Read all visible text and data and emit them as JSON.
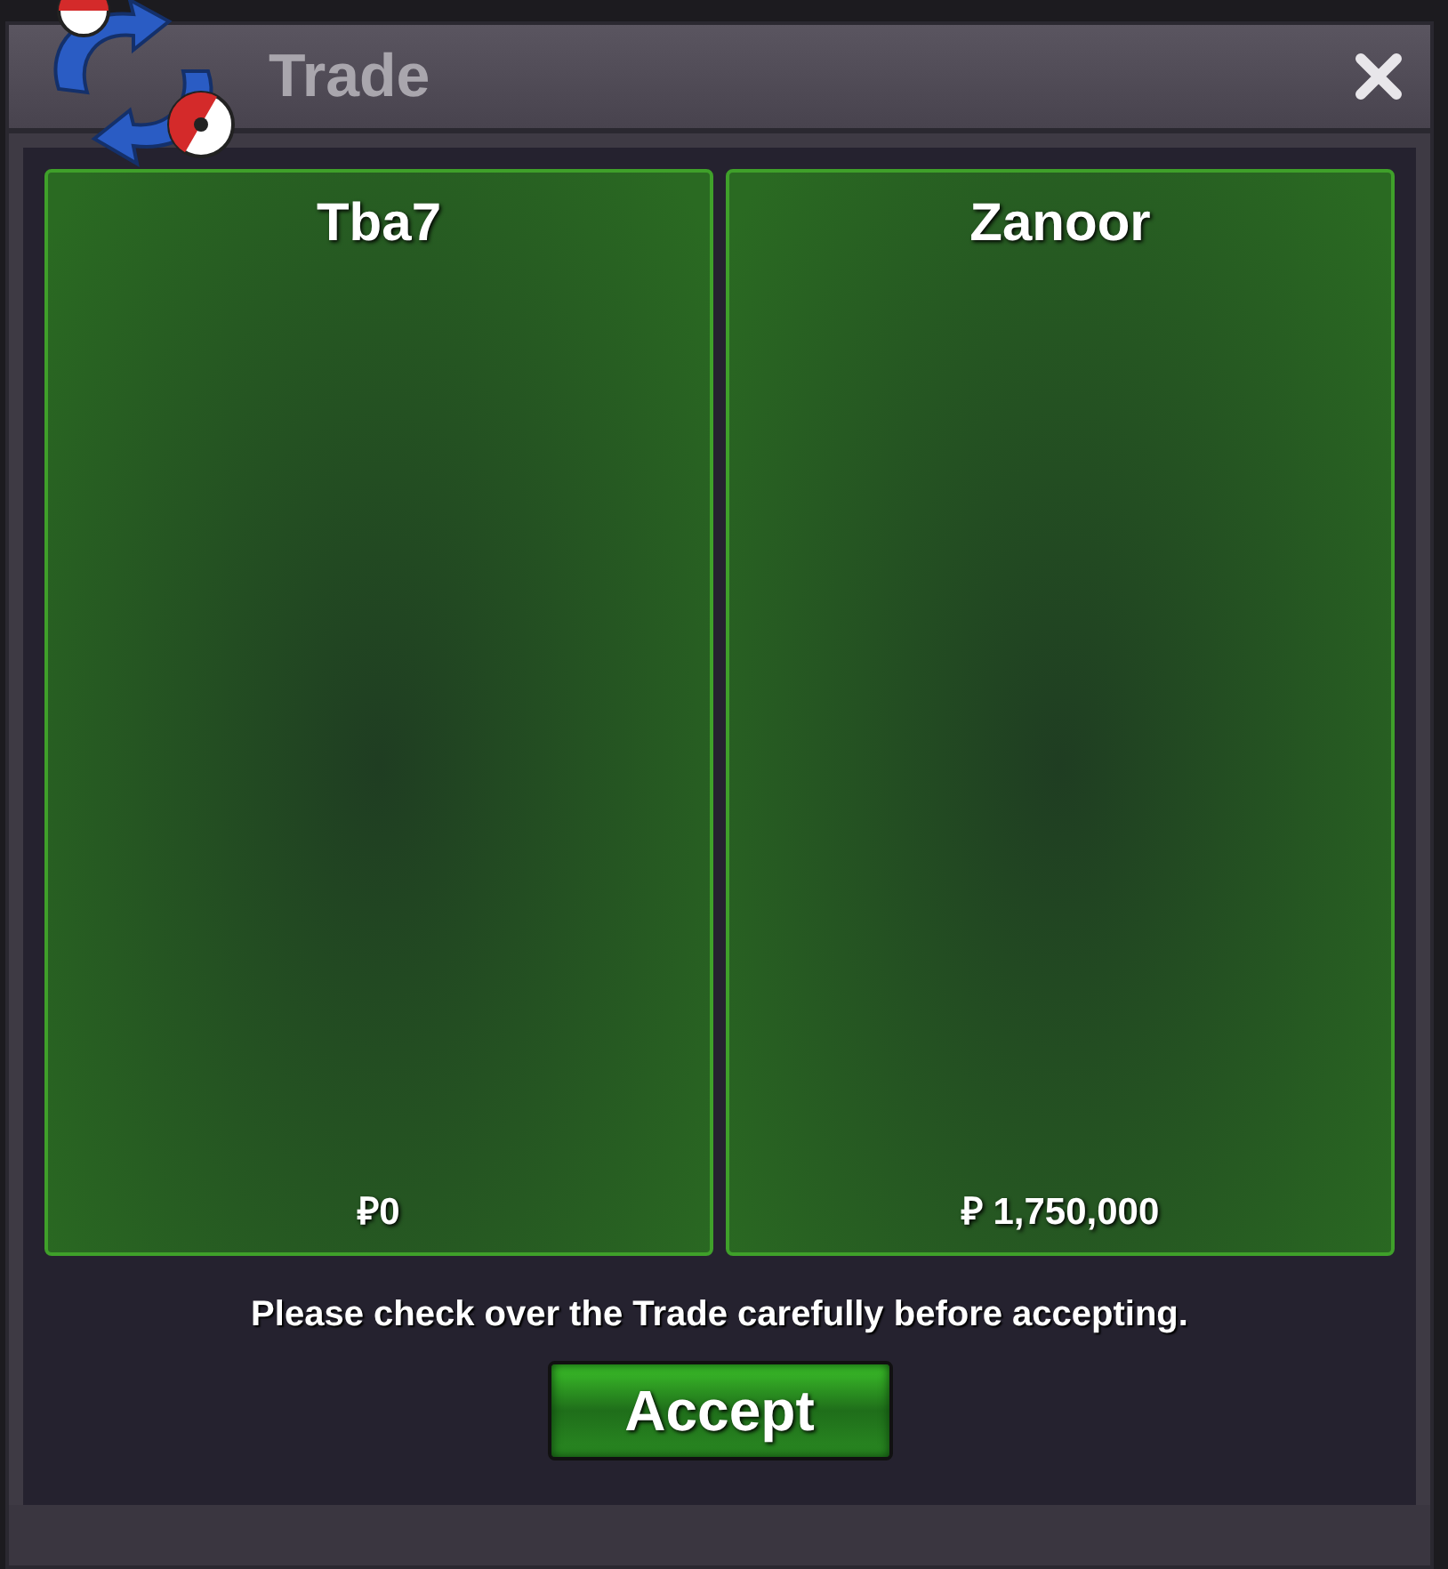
{
  "window": {
    "title": "Trade"
  },
  "offers": [
    {
      "trader": "Tba7",
      "money": "₽0"
    },
    {
      "trader": "Zanoor",
      "money": "₽ 1,750,000"
    }
  ],
  "notice": "Please check over the Trade carefully before accepting.",
  "buttons": [
    "Accept"
  ]
}
